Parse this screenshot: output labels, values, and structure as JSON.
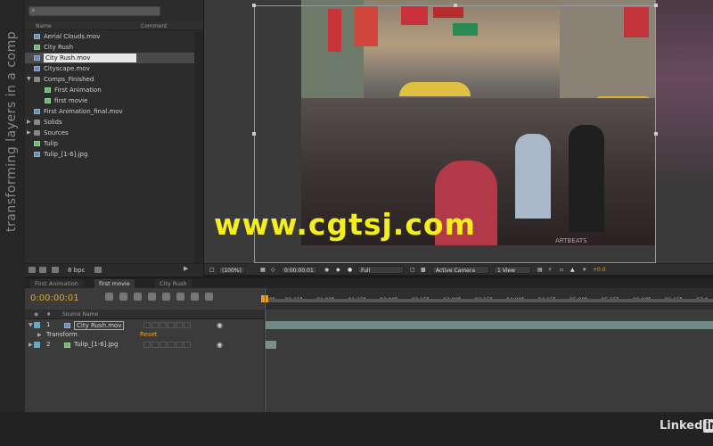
{
  "side_title": "transforming layers in a comp",
  "brand": {
    "text": "Linked",
    "in": "in"
  },
  "project": {
    "columns": {
      "name": "Name",
      "comment": "Comment"
    },
    "items": [
      {
        "label": "Aerial Clouds.mov",
        "kind": "footage",
        "indent": 1,
        "selected": false
      },
      {
        "label": "City Rush",
        "kind": "comp",
        "indent": 1,
        "selected": false
      },
      {
        "label": "City Rush.mov",
        "kind": "footage",
        "indent": 1,
        "selected": true
      },
      {
        "label": "Cityscape.mov",
        "kind": "footage",
        "indent": 1,
        "selected": false
      },
      {
        "label": "Comps_Finished",
        "kind": "folder",
        "indent": 0,
        "selected": false
      },
      {
        "label": "First Animation",
        "kind": "comp",
        "indent": 2,
        "selected": false
      },
      {
        "label": "first movie",
        "kind": "comp",
        "indent": 2,
        "selected": false
      },
      {
        "label": "First Animation_final.mov",
        "kind": "footage",
        "indent": 1,
        "selected": false
      },
      {
        "label": "Solids",
        "kind": "folder",
        "indent": 0,
        "selected": false
      },
      {
        "label": "Sources",
        "kind": "folder",
        "indent": 0,
        "selected": false
      },
      {
        "label": "Tulip",
        "kind": "comp",
        "indent": 1,
        "selected": false
      },
      {
        "label": "Tulip_[1-6].jpg",
        "kind": "footage",
        "indent": 1,
        "selected": false
      }
    ],
    "bpc": "8 bpc"
  },
  "watermark": "www.cgtsj.com",
  "photo_watermark": "ARTBEATS",
  "viewer_bar": {
    "zoom": "(100%)",
    "timecode": "0:00:00:01",
    "resolution": "Full",
    "camera": "Active Camera",
    "views": "1 View",
    "exposure": "+0.0"
  },
  "timeline": {
    "tabs": [
      "First Animation",
      "first movie",
      "City Rush"
    ],
    "active_tab": 1,
    "timecode": "0:00:00:01",
    "header": {
      "source_name": "Source Name"
    },
    "layers": [
      {
        "num": "1",
        "name": "City Rush.mov",
        "color": "#6aa7c7"
      },
      {
        "num": "2",
        "name": "Tulip_[1-6].jpg",
        "color": "#6aa7c7"
      }
    ],
    "transform": {
      "label": "Transform",
      "reset": "Reset"
    },
    "ruler": [
      "00f",
      "00:15f",
      "01:00f",
      "01:15f",
      "02:00f",
      "02:15f",
      "03:00f",
      "03:15f",
      "04:00f",
      "04:15f",
      "05:00f",
      "05:15f",
      "06:00f",
      "06:15f",
      "07:0"
    ]
  }
}
